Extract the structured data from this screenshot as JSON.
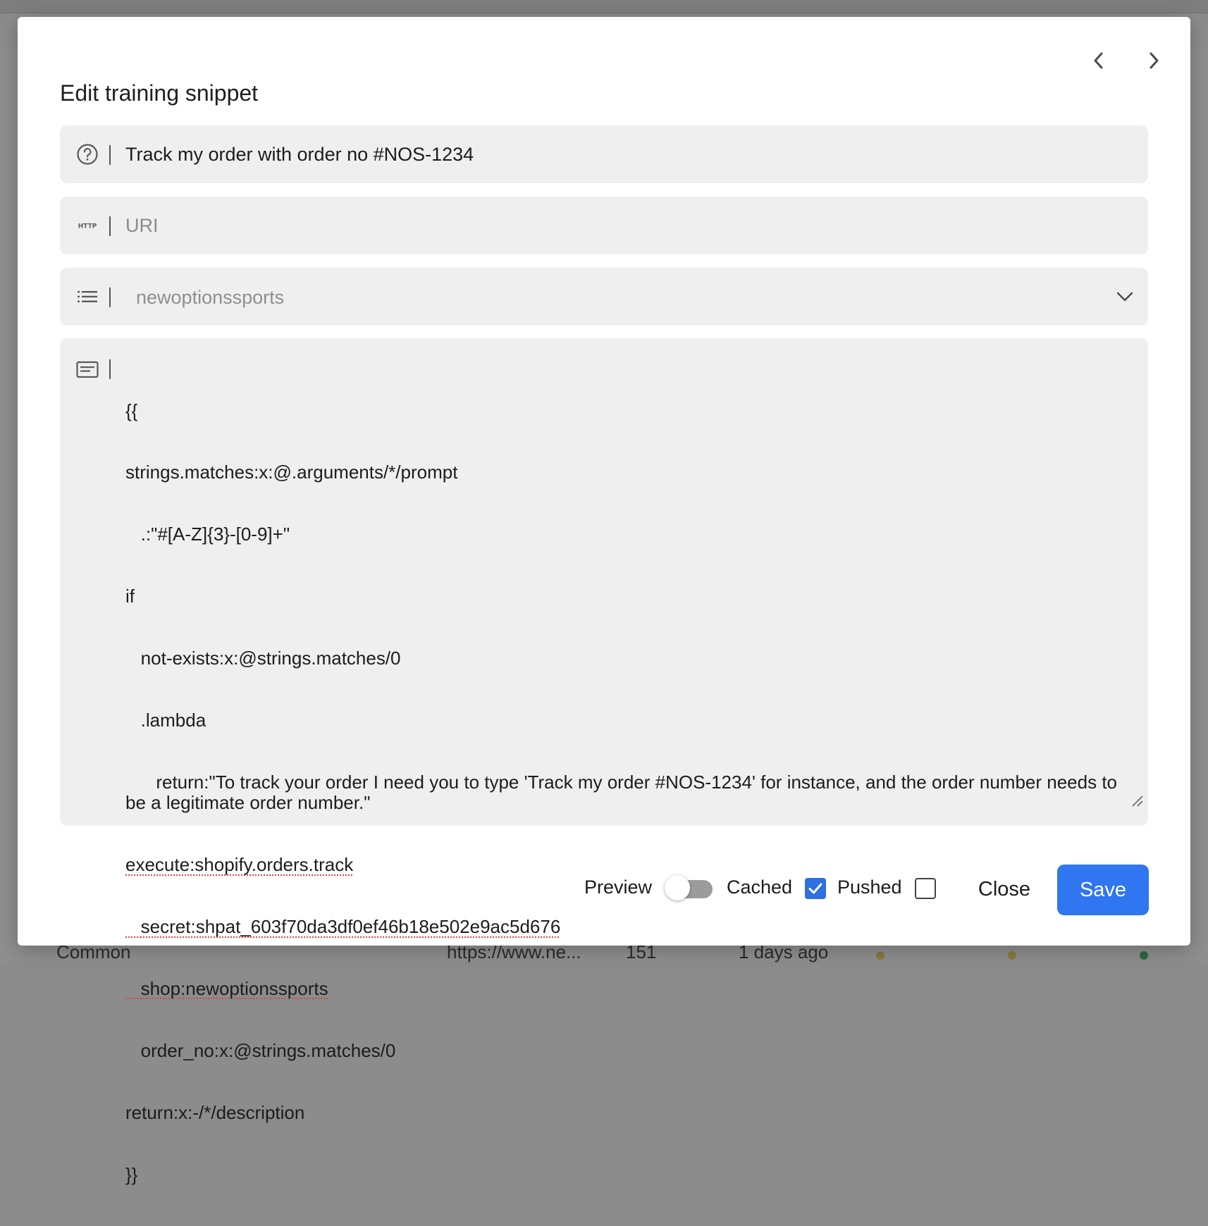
{
  "dialog": {
    "title": "Edit training snippet",
    "prev_icon": "chevron-left-icon",
    "next_icon": "chevron-right-icon"
  },
  "fields": {
    "prompt": {
      "icon": "question-circle-icon",
      "value": "Track my order with order no #NOS-1234"
    },
    "uri": {
      "icon": "http-icon",
      "placeholder": "URI"
    },
    "context": {
      "icon": "list-icon",
      "placeholder": "newoptionssports",
      "dropdown_icon": "chevron-down-icon"
    },
    "completion": {
      "icon": "text-box-icon",
      "lines": [
        "{{",
        "strings.matches:x:@.arguments/*/prompt",
        "   .:\"#[A-Z]{3}-[0-9]+\"",
        "if",
        "   not-exists:x:@strings.matches/0",
        "   .lambda",
        "      return:\"To track your order I need you to type 'Track my order #NOS-1234' for instance, and the order number needs to be a legitimate order number.\"",
        "execute:shopify.orders.track",
        "   secret: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",
        "   shop:newoptionssports",
        "   order_no:x:@strings.matches/0",
        "return:x:-/*/description",
        "}}"
      ]
    }
  },
  "footer": {
    "preview_label": "Preview",
    "preview_on": false,
    "cached_label": "Cached",
    "cached_checked": true,
    "pushed_label": "Pushed",
    "pushed_checked": false,
    "close_label": "Close",
    "save_label": "Save"
  },
  "background_row": {
    "type": "Common",
    "url": "https://www.ne...",
    "count": "151",
    "date": "1 days ago"
  },
  "colors": {
    "accent": "#2f76f0",
    "status_dot_1": "#8a7a3a",
    "status_dot_2": "#8a7a3a",
    "status_dot_3": "#2d6a3e"
  }
}
